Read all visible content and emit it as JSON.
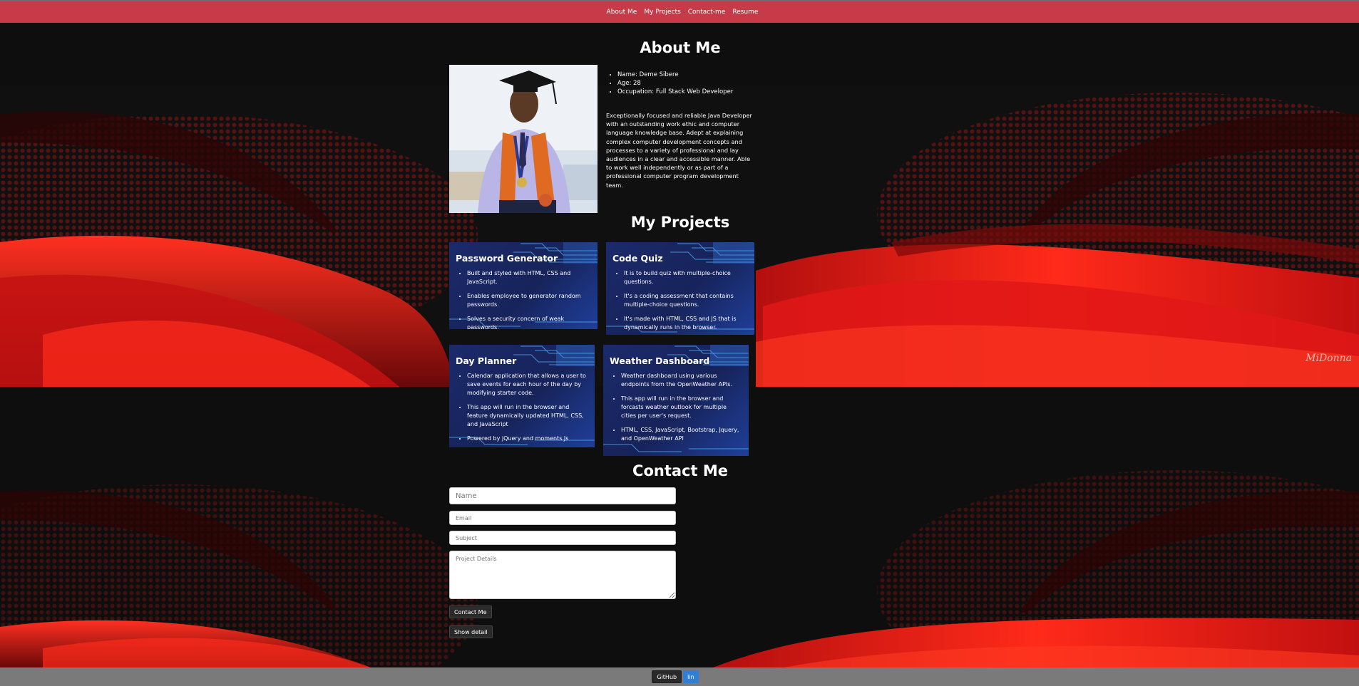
{
  "nav": {
    "items": [
      "About Me",
      "My Projects",
      "Contact-me",
      "Resume"
    ]
  },
  "about": {
    "title": "About Me",
    "details": [
      "Name: Deme Sibere",
      "Age: 28",
      "Occupation: Full Stack Web Developer"
    ],
    "bio": "Exceptionally focused and reliable Java Developer with an outstanding work ethic and computer language knowledge base. Adept at explaining complex computer development concepts and processes to a variety of professional and lay audiences in a clear and accessible manner. Able to work well independently or as part of a professional computer program development team."
  },
  "projects": {
    "title": "My Projects",
    "cards": [
      {
        "title": "Password Generator",
        "points": [
          "Built and styled with HTML, CSS and JavaScript.",
          "Enables employee to generator random passwords.",
          "Solves a security concern of weak passwords."
        ]
      },
      {
        "title": "Code Quiz",
        "points": [
          "It is to build quiz with multiple-choice questions.",
          "It's a coding assessment that contains multiple-choice questions.",
          "It's made with HTML, CSS and JS that is dynamically runs in the browser."
        ]
      },
      {
        "title": "Day Planner",
        "points": [
          "Calendar application that allows a user to save events for each hour of the day by modifying starter code.",
          "This app will run in the browser and feature dynamically updated HTML, CSS, and JavaScript",
          "Powered by jQuery and moments.Js"
        ]
      },
      {
        "title": "Weather Dashboard",
        "points": [
          "Weather dashboard using various endpoints from the OpenWeather APIs.",
          "This app will run in the browser and forcasts weather outlook for multiple cities per user's request.",
          "HTML, CSS, JavaScript, Bootstrap, Jquery, and OpenWeather API"
        ]
      }
    ]
  },
  "contact": {
    "title": "Contact Me",
    "name_placeholder": "Name",
    "email_placeholder": "Email",
    "subject_placeholder": "Subject",
    "details_placeholder": "Project Details",
    "submit_label": "Contact Me",
    "detail_label": "Show detail"
  },
  "footer": {
    "github_label": "GitHub",
    "linkedin_label": "lin"
  },
  "signature": "MiDonna",
  "colors": {
    "navbar": "#c83a48",
    "background": "#0e0e0e",
    "wave_red": "#e01818",
    "footer": "#7a7a7a",
    "card_blue": "#1b2a6b",
    "linkedin": "#2f7fd6"
  },
  "icons": [
    "circuit-pattern-art",
    "red-wave-background-art",
    "profile-photo-graduate"
  ]
}
